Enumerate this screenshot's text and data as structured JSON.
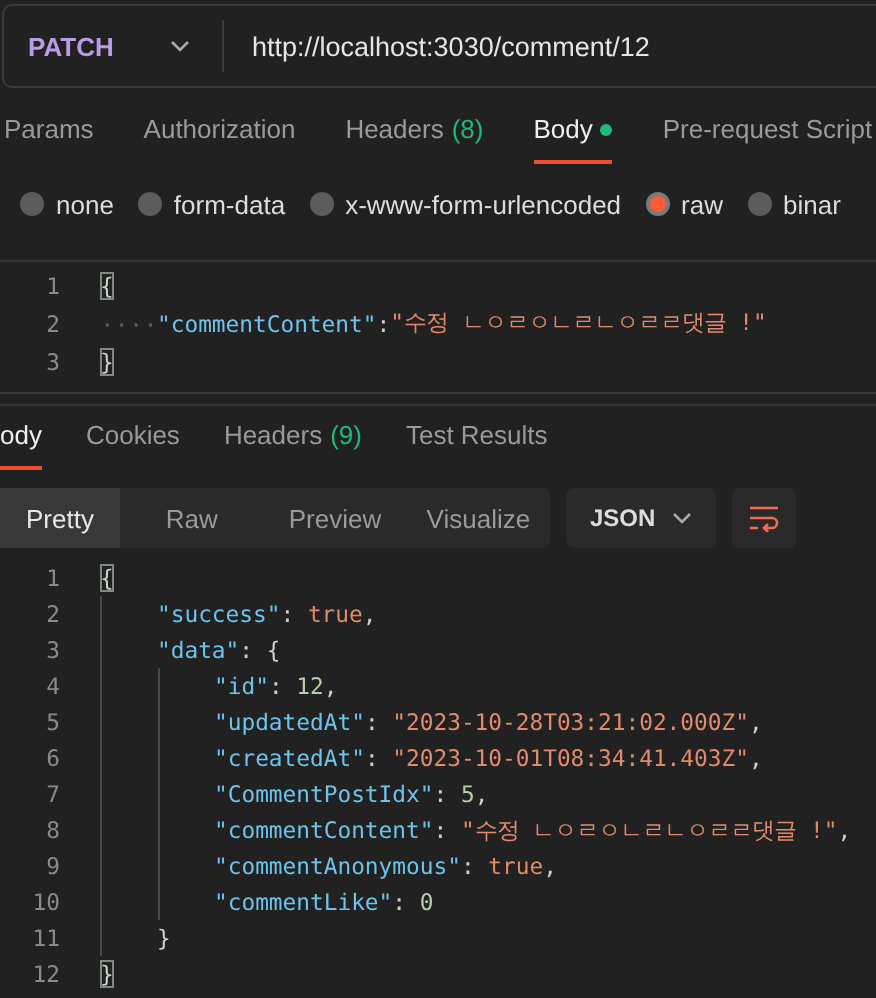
{
  "request": {
    "method": "PATCH",
    "url": "http://localhost:3030/comment/12"
  },
  "request_tabs": [
    {
      "label": "Params",
      "selected": false
    },
    {
      "label": "Authorization",
      "selected": false
    },
    {
      "label": "Headers",
      "count": "(8)",
      "selected": false
    },
    {
      "label": "Body",
      "selected": true,
      "dot": true
    },
    {
      "label": "Pre-request Script",
      "selected": false
    }
  ],
  "body_types": [
    {
      "label": "none",
      "selected": false
    },
    {
      "label": "form-data",
      "selected": false
    },
    {
      "label": "x-www-form-urlencoded",
      "selected": false
    },
    {
      "label": "raw",
      "selected": true
    },
    {
      "label": "binar",
      "selected": false
    }
  ],
  "request_body": {
    "whitespace_dots": true,
    "lines": [
      {
        "number": "1",
        "tokens": [
          {
            "kind": "punct",
            "text": "{",
            "matched": true
          }
        ],
        "children": [
          {
            "number": "2",
            "tokens": [
              {
                "kind": "key",
                "text": "\"commentContent\""
              },
              {
                "kind": "punct",
                "text": ":"
              },
              {
                "kind": "string",
                "text": "\"수정 ㄴㅇㄹㅇㄴㄹㄴㅇㄹㄹ댓글 !\""
              }
            ]
          }
        ]
      },
      {
        "number": "3",
        "tokens": [
          {
            "kind": "punct",
            "text": "}",
            "matched": true
          }
        ]
      }
    ]
  },
  "response_tabs": [
    {
      "label": "ody",
      "selected": true
    },
    {
      "label": "Cookies",
      "selected": false
    },
    {
      "label": "Headers",
      "count": "(9)",
      "selected": false
    },
    {
      "label": "Test Results",
      "selected": false
    }
  ],
  "view_modes": [
    {
      "label": "Pretty",
      "selected": true
    },
    {
      "label": "Raw",
      "selected": false
    },
    {
      "label": "Preview",
      "selected": false
    },
    {
      "label": "Visualize",
      "selected": false
    }
  ],
  "format": "JSON",
  "response_body": {
    "indent_guides": true,
    "lines": [
      {
        "number": "1",
        "tokens": [
          {
            "kind": "punct",
            "text": "{",
            "matched": true
          }
        ],
        "children": [
          {
            "number": "2",
            "tokens": [
              {
                "kind": "key",
                "text": "\"success\""
              },
              {
                "kind": "punct",
                "text": ": "
              },
              {
                "kind": "bool",
                "text": "true"
              },
              {
                "kind": "punct",
                "text": ","
              }
            ]
          },
          {
            "number": "3",
            "tokens": [
              {
                "kind": "key",
                "text": "\"data\""
              },
              {
                "kind": "punct",
                "text": ": {"
              }
            ],
            "children": [
              {
                "number": "4",
                "tokens": [
                  {
                    "kind": "key",
                    "text": "\"id\""
                  },
                  {
                    "kind": "punct",
                    "text": ": "
                  },
                  {
                    "kind": "number",
                    "text": "12"
                  },
                  {
                    "kind": "punct",
                    "text": ","
                  }
                ]
              },
              {
                "number": "5",
                "tokens": [
                  {
                    "kind": "key",
                    "text": "\"updatedAt\""
                  },
                  {
                    "kind": "punct",
                    "text": ": "
                  },
                  {
                    "kind": "string",
                    "text": "\"2023-10-28T03:21:02.000Z\""
                  },
                  {
                    "kind": "punct",
                    "text": ","
                  }
                ]
              },
              {
                "number": "6",
                "tokens": [
                  {
                    "kind": "key",
                    "text": "\"createdAt\""
                  },
                  {
                    "kind": "punct",
                    "text": ": "
                  },
                  {
                    "kind": "string",
                    "text": "\"2023-10-01T08:34:41.403Z\""
                  },
                  {
                    "kind": "punct",
                    "text": ","
                  }
                ]
              },
              {
                "number": "7",
                "tokens": [
                  {
                    "kind": "key",
                    "text": "\"CommentPostIdx\""
                  },
                  {
                    "kind": "punct",
                    "text": ": "
                  },
                  {
                    "kind": "number",
                    "text": "5"
                  },
                  {
                    "kind": "punct",
                    "text": ","
                  }
                ]
              },
              {
                "number": "8",
                "tokens": [
                  {
                    "kind": "key",
                    "text": "\"commentContent\""
                  },
                  {
                    "kind": "punct",
                    "text": ": "
                  },
                  {
                    "kind": "string",
                    "text": "\"수정 ㄴㅇㄹㅇㄴㄹㄴㅇㄹㄹ댓글 !\""
                  },
                  {
                    "kind": "punct",
                    "text": ","
                  }
                ]
              },
              {
                "number": "9",
                "tokens": [
                  {
                    "kind": "key",
                    "text": "\"commentAnonymous\""
                  },
                  {
                    "kind": "punct",
                    "text": ": "
                  },
                  {
                    "kind": "bool",
                    "text": "true"
                  },
                  {
                    "kind": "punct",
                    "text": ","
                  }
                ]
              },
              {
                "number": "10",
                "tokens": [
                  {
                    "kind": "key",
                    "text": "\"commentLike\""
                  },
                  {
                    "kind": "punct",
                    "text": ": "
                  },
                  {
                    "kind": "number",
                    "text": "0"
                  }
                ]
              }
            ]
          },
          {
            "number": "11",
            "tokens": [
              {
                "kind": "punct",
                "text": "}"
              }
            ]
          }
        ]
      },
      {
        "number": "12",
        "tokens": [
          {
            "kind": "punct",
            "text": "}",
            "matched": true
          }
        ]
      }
    ]
  }
}
